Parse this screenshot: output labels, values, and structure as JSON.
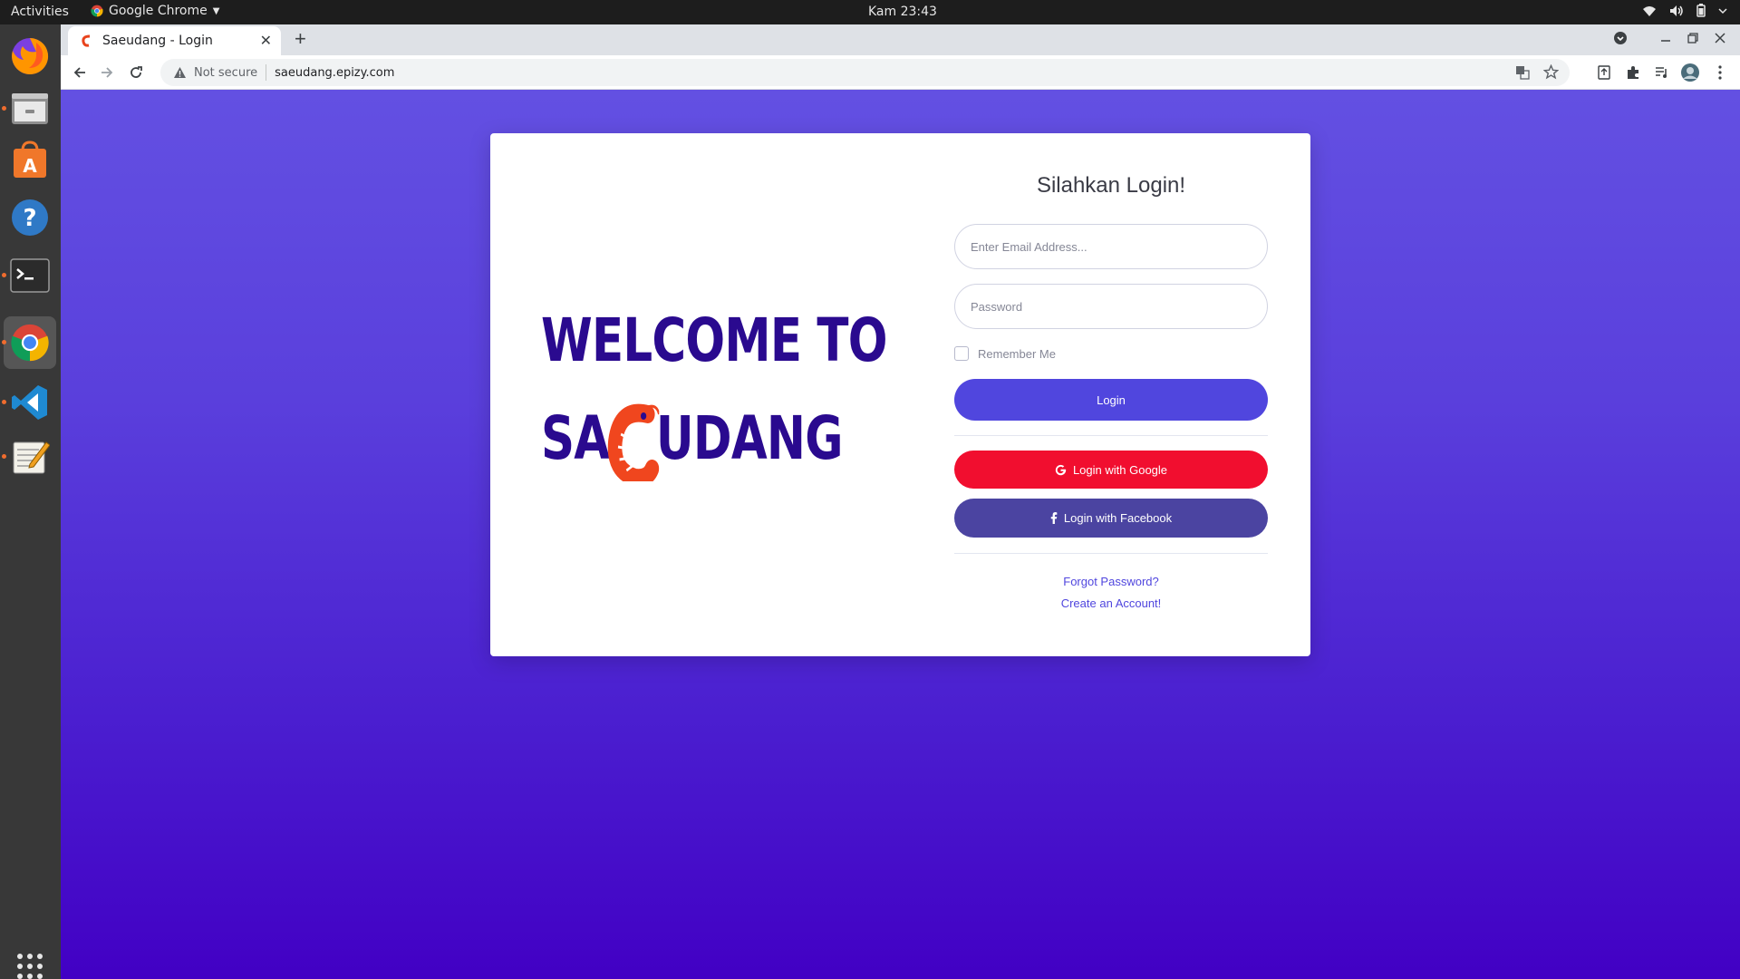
{
  "system": {
    "activities": "Activities",
    "app_name": "Google Chrome",
    "clock": "Kam 23:43"
  },
  "browser": {
    "tab_title": "Saeudang - Login",
    "security_label": "Not secure",
    "url": "saeudang.epizy.com"
  },
  "hero": {
    "line1": "WELCOME TO",
    "line2_prefix": "SA",
    "line2_suffix": "UDANG"
  },
  "login": {
    "title": "Silahkan Login!",
    "email_placeholder": "Enter Email Address...",
    "password_placeholder": "Password",
    "remember_label": "Remember Me",
    "login_button": "Login",
    "google_button": "Login with Google",
    "facebook_button": "Login with Facebook",
    "forgot_link": "Forgot Password?",
    "create_link": "Create an Account!"
  },
  "colors": {
    "accent": "#5046de",
    "google": "#f10e2f",
    "facebook": "#4b44a1",
    "hero_text": "#2a0a8f"
  }
}
